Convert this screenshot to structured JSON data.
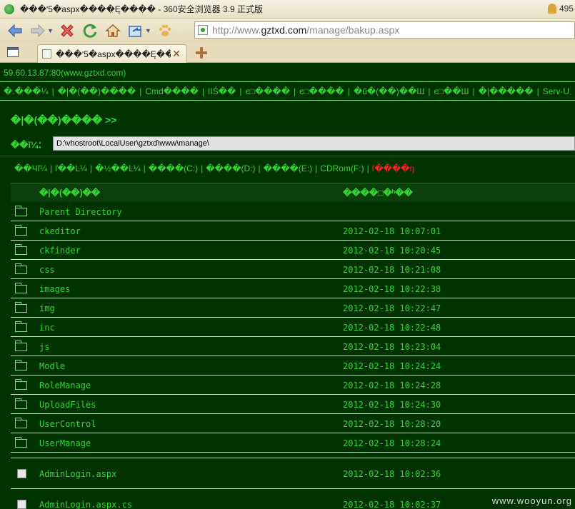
{
  "window": {
    "title": "���ʹ5�aspx����Ę���� - 360安全浏览器 3.9 正式版",
    "user_count": "495"
  },
  "toolbar": {
    "icons": [
      "back-icon",
      "forward-icon",
      "stop-icon",
      "refresh-icon",
      "home-icon",
      "restore-icon",
      "paw-icon"
    ],
    "url_prefix": "http://www.",
    "url_host": "gztxd.com",
    "url_path": "/manage/bakup.aspx"
  },
  "tabs": [
    {
      "label": "���ʹ5�aspx����Ę����"
    }
  ],
  "page": {
    "host": "59.60.13.87:80(www.gztxd.com)",
    "menu": [
      "�.���¼",
      "�|�(��)����",
      "Cmd����",
      "IIŚ��",
      "є□����",
      "є□����",
      "�ű�(��)��Ш",
      "є□��Ш",
      "�|�����",
      "Serv-U"
    ],
    "heading": "�|�(��)���� >>",
    "path_label": "��ǐ¼：",
    "path_value": "D:\\vhostroot\\LocalUser\\gztxd\\www\\manage\\",
    "drives": [
      "��Чľ¼",
      "ľ��Ŀ¼",
      "�½��Ŀ¼",
      "����(C:)",
      "����(D:)",
      "����(E:)",
      "CDRom(F:)"
    ],
    "drive_warning": "ľ����ŋ",
    "colors": {
      "background": "#003300",
      "text": "#34d334",
      "warning": "#ff2020"
    }
  },
  "table": {
    "header_name": "�|�(��)��",
    "header_time": "����□�ʰ��",
    "parent_label": "Parent Directory",
    "folders": [
      {
        "name": "ckeditor",
        "time": "2012-02-18 10:07:01"
      },
      {
        "name": "ckfinder",
        "time": "2012-02-18 10:20:45"
      },
      {
        "name": "css",
        "time": "2012-02-18 10:21:08"
      },
      {
        "name": "images",
        "time": "2012-02-18 10:22:38"
      },
      {
        "name": "img",
        "time": "2012-02-18 10:22:47"
      },
      {
        "name": "inc",
        "time": "2012-02-18 10:22:48"
      },
      {
        "name": "js",
        "time": "2012-02-18 10:23:04"
      },
      {
        "name": "Modle",
        "time": "2012-02-18 10:24:24"
      },
      {
        "name": "RoleManage",
        "time": "2012-02-18 10:24:28"
      },
      {
        "name": "UploadFiles",
        "time": "2012-02-18 10:24:30"
      },
      {
        "name": "UserControl",
        "time": "2012-02-18 10:28:20"
      },
      {
        "name": "UserManage",
        "time": "2012-02-18 10:28:24"
      }
    ],
    "files": [
      {
        "name": "AdminLogin.aspx",
        "time": "2012-02-18 10:02:36"
      },
      {
        "name": "AdminLogin.aspx.cs",
        "time": "2012-02-18 10:02:37"
      }
    ]
  },
  "watermark": "www.wooyun.org"
}
